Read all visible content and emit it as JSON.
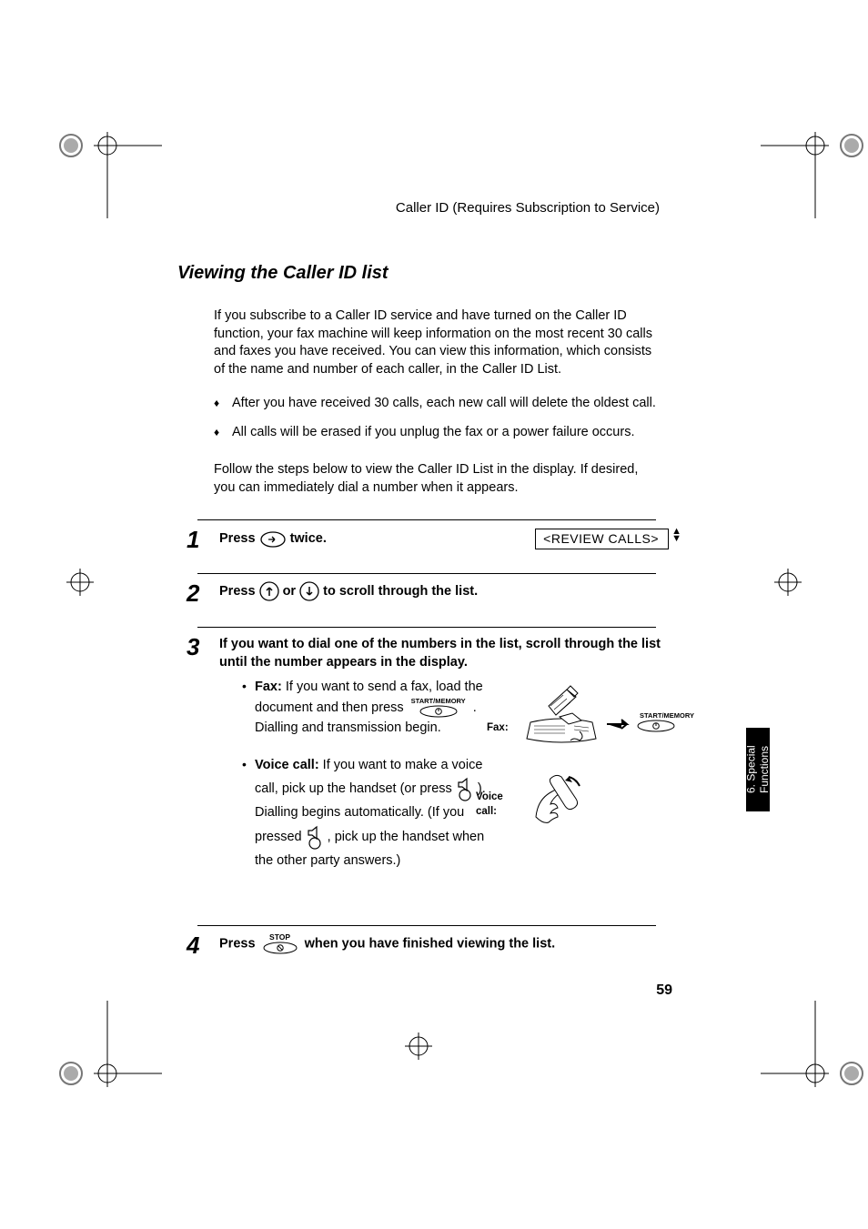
{
  "header": {
    "running_head": "Caller ID (Requires Subscription to Service)"
  },
  "section_title": "Viewing the Caller ID list",
  "intro": "If you subscribe to a Caller ID service and have turned on the Caller ID function, your fax machine will keep information on the most recent 30 calls and faxes you have received. You can view this information, which consists of the name and number of each caller, in the Caller ID List.",
  "bullets": [
    "After you have received 30 calls, each new call will delete the oldest call.",
    "All calls will be erased if you unplug the fax or a power failure occurs."
  ],
  "follow_text": "Follow the steps below to view the Caller ID List in the display. If desired, you can immediately dial a number when it appears.",
  "lcd_text": "<REVIEW CALLS>",
  "steps": {
    "1": {
      "pre": "Press",
      "post": "twice."
    },
    "2": {
      "pre": "Press",
      "mid": "or",
      "post": "to  scroll through the list."
    },
    "3": {
      "lead": "If you want to dial one of the numbers in the list, scroll through the list until the number appears in the display.",
      "fax_label": "Fax:",
      "fax_1": " If you want to send a fax, load the document and then press ",
      "fax_2": " . Dialling and transmission begin.",
      "voice_label": "Voice call:",
      "voice_1": " If you want to make a voice call, pick up the handset (or press ",
      "voice_2": " ). Dialling begins automatically. (If you pressed ",
      "voice_3": " , pick up the handset when the other party answers.)",
      "illus_fax_tag": "Fax:",
      "illus_voice_tag": "Voice\ncall:",
      "illus_startmem": "START/MEMORY"
    },
    "4": {
      "pre": "Press",
      "post": "when you have finished viewing the list."
    }
  },
  "key_labels": {
    "start_memory": "START/MEMORY",
    "stop": "STOP"
  },
  "side_tab": "6. Special\nFunctions",
  "page_number": "59"
}
